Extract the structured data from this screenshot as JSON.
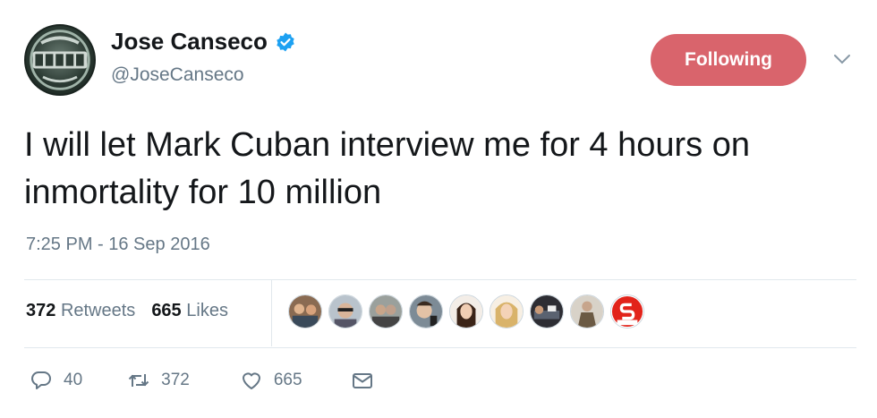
{
  "user": {
    "name": "Jose Canseco",
    "handle": "@JoseCanseco",
    "avatar_icon": "canseco-logo-avatar",
    "verified_icon": "verified-badge-icon"
  },
  "follow_button": {
    "label": "Following",
    "color": "#d9646c"
  },
  "tweet": {
    "text": "I will let Mark Cuban interview me for 4 hours on inmortality for 10 million",
    "timestamp": "7:25 PM - 16 Sep 2016"
  },
  "stats": {
    "retweets_count": "372",
    "retweets_label": "Retweets",
    "likes_count": "665",
    "likes_label": "Likes"
  },
  "likers": [
    "group-photo-avatar",
    "sunglasses-avatar",
    "couple-avatar",
    "selfie-avatar",
    "woman-portrait-avatar",
    "blonde-woman-avatar",
    "reclining-man-avatar",
    "coat-man-avatar",
    "sports-logo-avatar"
  ],
  "actions": {
    "reply_count": "40",
    "retweet_count": "372",
    "like_count": "665"
  },
  "colors": {
    "text": "#14171a",
    "secondary": "#657786",
    "verified": "#1da1f2",
    "divider": "#e1e8ed"
  }
}
